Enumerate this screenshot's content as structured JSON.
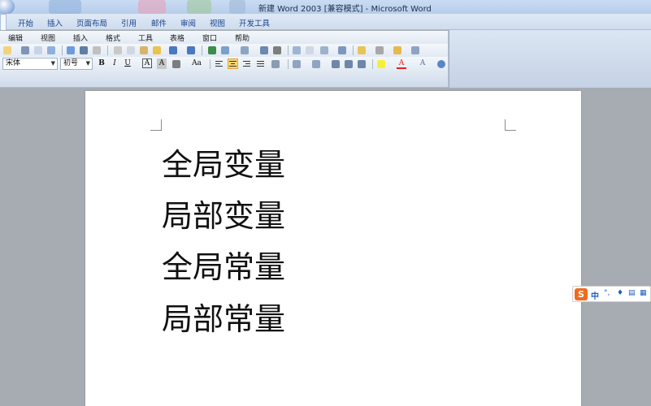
{
  "window": {
    "title": "新建 Word 2003 [兼容模式] - Microsoft Word"
  },
  "ribbon_tabs": [
    {
      "label": "开始"
    },
    {
      "label": "插入"
    },
    {
      "label": "页面布局"
    },
    {
      "label": "引用"
    },
    {
      "label": "邮件"
    },
    {
      "label": "审阅"
    },
    {
      "label": "视图"
    },
    {
      "label": "开发工具"
    }
  ],
  "menus": [
    {
      "label": "编辑"
    },
    {
      "label": "视图"
    },
    {
      "label": "插入"
    },
    {
      "label": "格式"
    },
    {
      "label": "工具"
    },
    {
      "label": "表格"
    },
    {
      "label": "窗口"
    },
    {
      "label": "帮助"
    }
  ],
  "format": {
    "font_name": "宋体",
    "font_size": "初号",
    "bold": "B",
    "italic": "I",
    "underline": "U",
    "char_border": "A",
    "char_shading": "A",
    "change_case": "Aa",
    "alignment": "center"
  },
  "document": {
    "lines": [
      "全局变量",
      "局部变量",
      "全局常量",
      "局部常量"
    ]
  },
  "ime": {
    "logo": "S",
    "mode": "中"
  },
  "colors": {
    "font_color": "#e02020",
    "highlight_color": "#ffff00",
    "ime_brand": "#f26b1d"
  }
}
